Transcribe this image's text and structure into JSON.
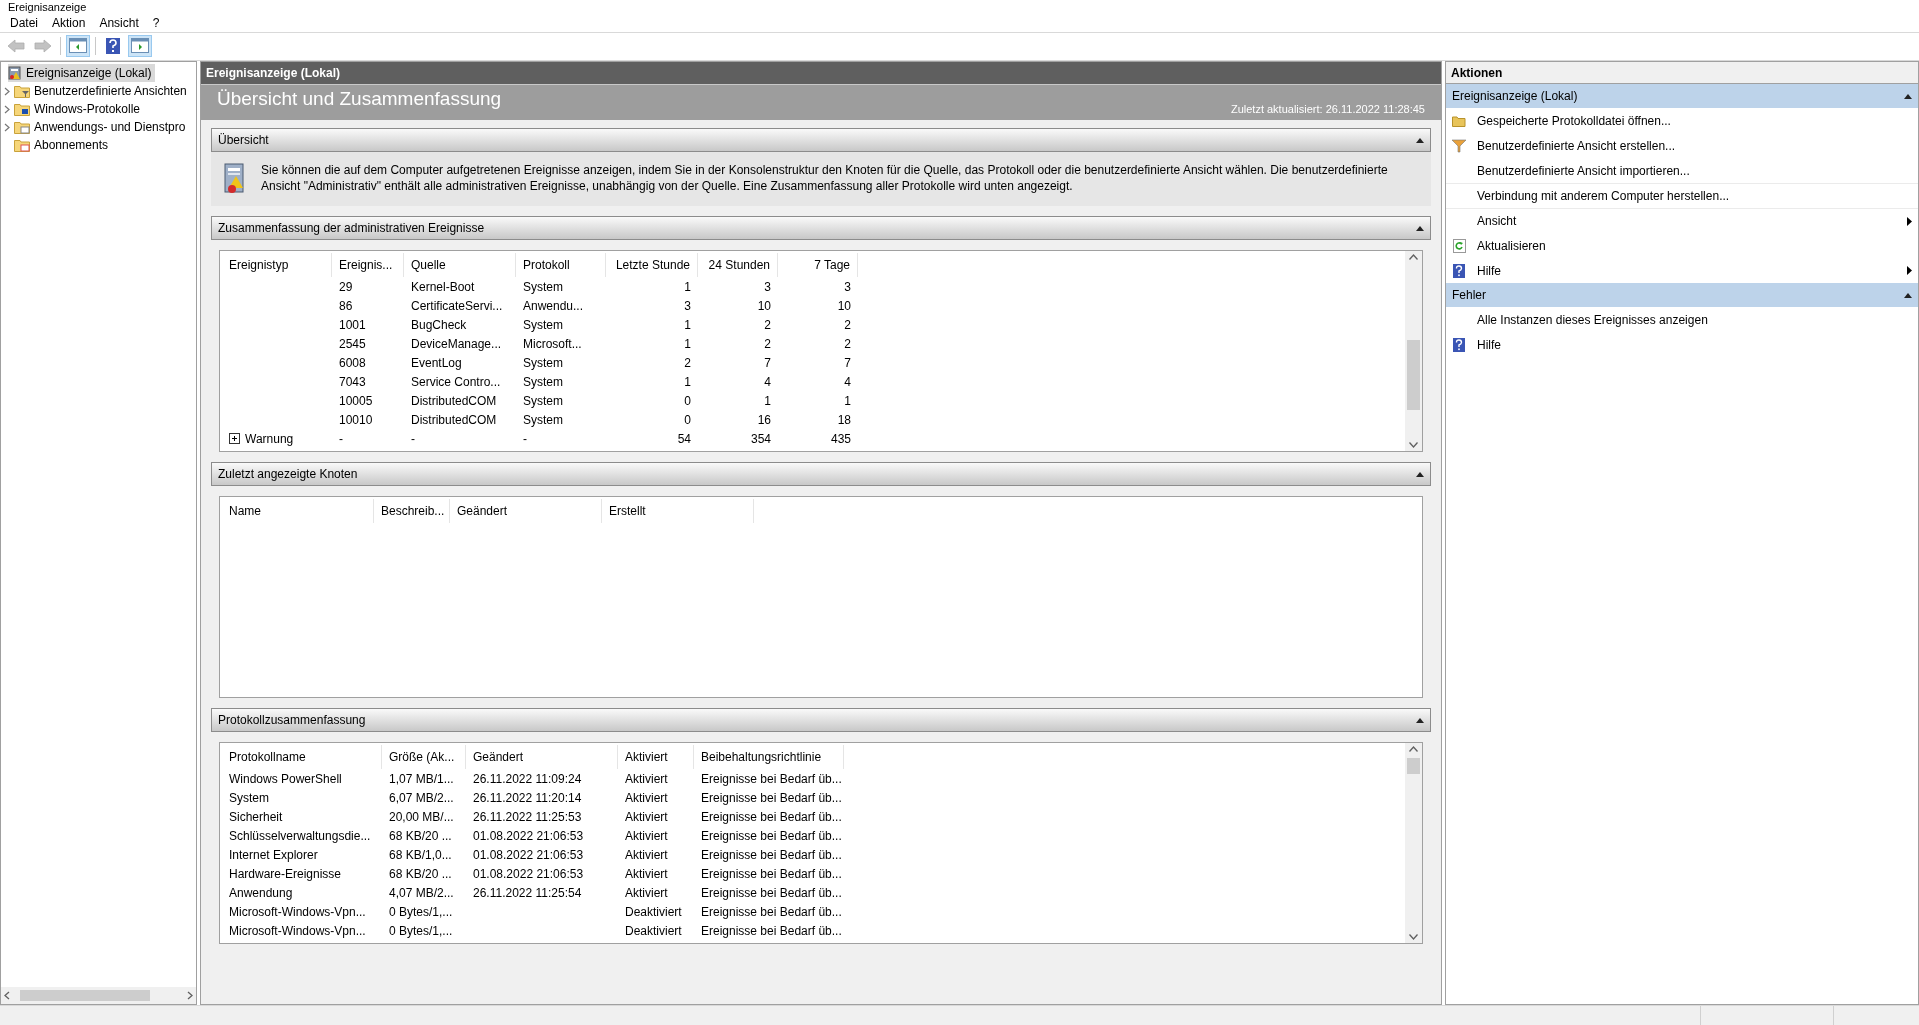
{
  "window": {
    "title": "Ereignisanzeige"
  },
  "menu": [
    "Datei",
    "Aktion",
    "Ansicht",
    "?"
  ],
  "toolbar": [
    {
      "kind": "back",
      "on": false,
      "disabled": true
    },
    {
      "kind": "forward",
      "on": false,
      "disabled": true
    },
    {
      "kind": "tree-pane",
      "on": true,
      "disabled": false
    },
    {
      "kind": "help",
      "on": false,
      "disabled": false
    },
    {
      "kind": "action-pane",
      "on": true,
      "disabled": false
    }
  ],
  "tree": [
    {
      "label": "Ereignisanzeige (Lokal)",
      "selected": true,
      "expandable": false,
      "kind": "root"
    },
    {
      "label": "Benutzerdefinierte Ansichten",
      "selected": false,
      "expandable": true,
      "kind": "filter"
    },
    {
      "label": "Windows-Protokolle",
      "selected": false,
      "expandable": true,
      "kind": "logs"
    },
    {
      "label": "Anwendungs- und Dienstpro",
      "selected": false,
      "expandable": true,
      "kind": "folder"
    },
    {
      "label": "Abonnements",
      "selected": false,
      "expandable": false,
      "kind": "subscription"
    }
  ],
  "content": {
    "header": "Ereignisanzeige (Lokal)",
    "title": "Übersicht und Zusammenfassung",
    "updated": "Zuletzt aktualisiert: 26.11.2022 11:28:45",
    "overview": {
      "title": "Übersicht",
      "expanded": true,
      "text": "Sie können die auf dem Computer aufgetretenen Ereignisse anzeigen, indem Sie in der Konsolenstruktur den Knoten für die Quelle, das Protokoll oder die benutzerdefinierte Ansicht wählen. Die benutzerdefinierte Ansicht \"Administrativ\" enthält alle administrativen Ereignisse, unabhängig von der Quelle. Eine Zusammenfassung aller Protokolle wird unten angezeigt."
    },
    "summary": {
      "title": "Zusammenfassung der administrativen Ereignisse",
      "expanded": true,
      "columns": [
        {
          "label": "Ereignistyp",
          "numeric": false
        },
        {
          "label": "Ereignis...",
          "numeric": false
        },
        {
          "label": "Quelle",
          "numeric": false
        },
        {
          "label": "Protokoll",
          "numeric": false
        },
        {
          "label": "Letzte Stunde",
          "numeric": true
        },
        {
          "label": "24 Stunden",
          "numeric": true
        },
        {
          "label": "7 Tage",
          "numeric": true
        }
      ],
      "rows": [
        {
          "kind": "event",
          "cells": [
            "",
            "29",
            "Kernel-Boot",
            "System",
            "1",
            "3",
            "3"
          ]
        },
        {
          "kind": "event",
          "cells": [
            "",
            "86",
            "CertificateServi...",
            "Anwendu...",
            "3",
            "10",
            "10"
          ]
        },
        {
          "kind": "event",
          "cells": [
            "",
            "1001",
            "BugCheck",
            "System",
            "1",
            "2",
            "2"
          ]
        },
        {
          "kind": "event",
          "cells": [
            "",
            "2545",
            "DeviceManage...",
            "Microsoft...",
            "1",
            "2",
            "2"
          ]
        },
        {
          "kind": "event",
          "cells": [
            "",
            "6008",
            "EventLog",
            "System",
            "2",
            "7",
            "7"
          ]
        },
        {
          "kind": "event",
          "cells": [
            "",
            "7043",
            "Service Contro...",
            "System",
            "1",
            "4",
            "4"
          ]
        },
        {
          "kind": "event",
          "cells": [
            "",
            "10005",
            "DistributedCOM",
            "System",
            "0",
            "1",
            "1"
          ]
        },
        {
          "kind": "event",
          "cells": [
            "",
            "10010",
            "DistributedCOM",
            "System",
            "0",
            "16",
            "18"
          ]
        },
        {
          "kind": "group",
          "expanded": false,
          "cells": [
            "Warnung",
            "-",
            "-",
            "-",
            "54",
            "354",
            "435"
          ]
        }
      ]
    },
    "recent": {
      "title": "Zuletzt angezeigte Knoten",
      "expanded": true,
      "columns": [
        "Name",
        "Beschreib...",
        "Geändert",
        "Erstellt"
      ]
    },
    "logs": {
      "title": "Protokollzusammenfassung",
      "expanded": true,
      "columns": [
        "Protokollname",
        "Größe (Ak...",
        "Geändert",
        "Aktiviert",
        "Beibehaltungsrichtlinie"
      ],
      "rows": [
        {
          "name": "Windows PowerShell",
          "size": "1,07 MB/1...",
          "changed": "26.11.2022 11:09:24",
          "status": "Aktiviert",
          "retention": "Ereignisse bei Bedarf üb..."
        },
        {
          "name": "System",
          "size": "6,07 MB/2...",
          "changed": "26.11.2022 11:20:14",
          "status": "Aktiviert",
          "retention": "Ereignisse bei Bedarf üb..."
        },
        {
          "name": "Sicherheit",
          "size": "20,00 MB/...",
          "changed": "26.11.2022 11:25:53",
          "status": "Aktiviert",
          "retention": "Ereignisse bei Bedarf üb..."
        },
        {
          "name": "Schlüsselverwaltungsdie...",
          "size": "68 KB/20 ...",
          "changed": "01.08.2022 21:06:53",
          "status": "Aktiviert",
          "retention": "Ereignisse bei Bedarf üb..."
        },
        {
          "name": "Internet Explorer",
          "size": "68 KB/1,0...",
          "changed": "01.08.2022 21:06:53",
          "status": "Aktiviert",
          "retention": "Ereignisse bei Bedarf üb..."
        },
        {
          "name": "Hardware-Ereignisse",
          "size": "68 KB/20 ...",
          "changed": "01.08.2022 21:06:53",
          "status": "Aktiviert",
          "retention": "Ereignisse bei Bedarf üb..."
        },
        {
          "name": "Anwendung",
          "size": "4,07 MB/2...",
          "changed": "26.11.2022 11:25:54",
          "status": "Aktiviert",
          "retention": "Ereignisse bei Bedarf üb..."
        },
        {
          "name": "Microsoft-Windows-Vpn...",
          "size": "0 Bytes/1,...",
          "status": "Deaktiviert",
          "retention": "Ereignisse bei Bedarf üb..."
        },
        {
          "name": "Microsoft-Windows-Vpn...",
          "size": "0 Bytes/1,...",
          "status": "Deaktiviert",
          "retention": "Ereignisse bei Bedarf üb..."
        }
      ]
    }
  },
  "actions": {
    "title": "Aktionen",
    "groups": [
      {
        "title": "Ereignisanzeige (Lokal)",
        "expanded": true,
        "items": [
          {
            "label": "Gespeicherte Protokolldatei öffnen...",
            "kind": "folder",
            "submenu": false
          },
          {
            "label": "Benutzerdefinierte Ansicht erstellen...",
            "kind": "filter",
            "submenu": false
          },
          {
            "label": "Benutzerdefinierte Ansicht importieren...",
            "kind": "plain",
            "submenu": false
          },
          {
            "label": "Verbindung mit anderem Computer herstellen...",
            "kind": "plain",
            "submenu": false
          },
          {
            "label": "Ansicht",
            "kind": "plain",
            "submenu": true
          },
          {
            "label": "Aktualisieren",
            "kind": "refresh",
            "submenu": false
          },
          {
            "label": "Hilfe",
            "kind": "help",
            "submenu": true
          }
        ]
      },
      {
        "title": "Fehler",
        "expanded": true,
        "items": [
          {
            "label": "Alle Instanzen dieses Ereignisses anzeigen",
            "kind": "plain",
            "submenu": false
          },
          {
            "label": "Hilfe",
            "kind": "help",
            "submenu": false
          }
        ]
      }
    ]
  }
}
